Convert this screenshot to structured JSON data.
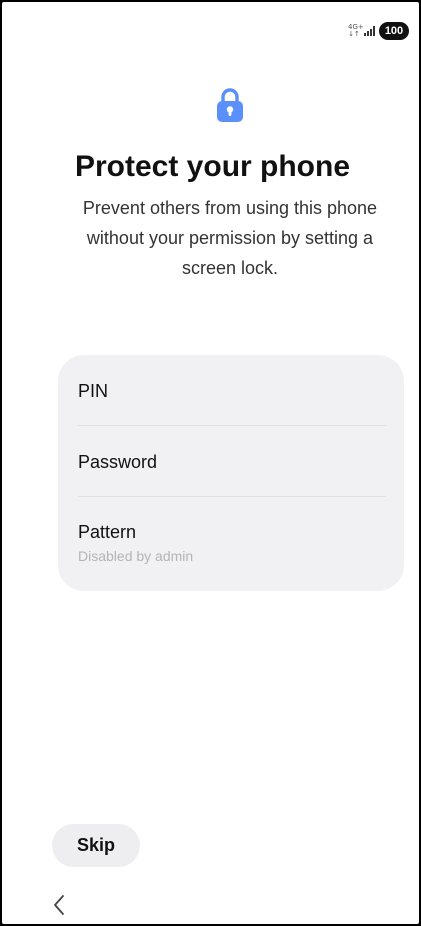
{
  "status_bar": {
    "network_type_top": "4G+",
    "network_type_bottom": "↓↑",
    "battery_level": "100"
  },
  "header": {
    "title": "Protect your phone",
    "subtitle": "Prevent others from using this phone without your permission by setting a screen lock."
  },
  "options": {
    "pin": {
      "label": "PIN"
    },
    "password": {
      "label": "Password"
    },
    "pattern": {
      "label": "Pattern",
      "status": "Disabled by admin"
    }
  },
  "footer": {
    "skip_label": "Skip"
  },
  "icons": {
    "lock": "lock-icon",
    "back": "chevron-left-icon",
    "signal": "signal-icon"
  },
  "colors": {
    "accent": "#5b8ff9",
    "card_background": "#f1f1f3",
    "disabled_text": "#b4b4b8"
  }
}
